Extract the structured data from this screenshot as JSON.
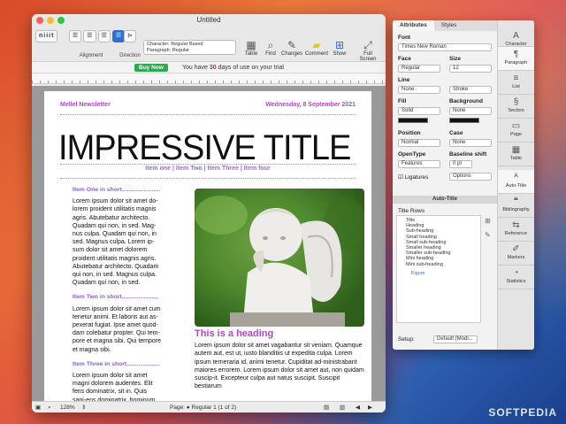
{
  "window": {
    "title": "Untitled"
  },
  "toolbar": {
    "logo": "niiit",
    "alignment_label": "Alignment",
    "direction_label": "Direction",
    "style_box_line1": "Character: Regular Based",
    "style_box_line2": "Paragraph: Regular",
    "tools": [
      {
        "label": "Table",
        "icon": "table-icon"
      },
      {
        "label": "Find",
        "icon": "find-icon"
      },
      {
        "label": "Changes",
        "icon": "changes-icon"
      },
      {
        "label": "Comment",
        "icon": "comment-icon"
      },
      {
        "label": "Show",
        "icon": "show-icon"
      },
      {
        "label": "Full Screen",
        "icon": "fullscreen-icon"
      }
    ]
  },
  "trial": {
    "buy_label": "Buy Now",
    "text_prefix": "You have",
    "days": "30",
    "text_suffix": "days of use on your trial"
  },
  "document": {
    "header_left": "Mellel Newsletter",
    "header_right": "Wednesday, 8 September 2021",
    "title": "IMPRESSIVE TITLE",
    "items_line": "Item one | Item Two | Item Three | Item four",
    "sec1_head": "Item One in short.......................",
    "sec1_text": "Lorem ipsum dolor sit amet do-lorem proident utilitatis magnis agris. Abutebatur architecto. Quadam qui non, in sed. Mag-nus culpa. Quadam qui non, in sed. Magnus culpa. Lorem ip-sum dolor sit amet dolorem proident utilitatis magnis agris. Abutebatur architecto. Quadam qui non, in sed. Magnus culpa. Quadam qui non, in sed.",
    "sec2_head": "Item Two in short......................",
    "sec2_text": "Lorem ipsum dolor sit amet cum tenetur animi. Et laboris aut as-pexerat fugiat. Ipse amet quod-dam colebatur propter. Qui tem-pore et magna sibi. Qui tempore et magna sibi.",
    "sec3_head": "Item Three in short....................",
    "sec3_text": "Lorem ipsum dolor sit amet magni dolorem audentes. Elit feris dominatrix, sit in. Quis sapi-ens dominatrix, hominum virtus",
    "heading": "This is a heading",
    "right_text": "Lorem ipsum dolor sit amet vagabantur sit veniam. Quamque autem aut, est ut, iusto blanditiis ut expedita culpa. Lorem ipsum terneraria id, animi tenetur. Cupiditat ad-ministrabant maiores errorem. Lorem ipsum dolor sit amet aut, non quidam suscip-it. Excepteur culpa aut natus suscipit. Suscipit bestiarum"
  },
  "status": {
    "zoom": "128%",
    "page_text": "Page: ● Regular 1 (1 of 2)"
  },
  "panel": {
    "tab_attributes": "Attributes",
    "tab_styles": "Styles",
    "font_label": "Font",
    "font_value": "Times New Roman",
    "face_label": "Face",
    "face_value": "Regular",
    "size_label": "Size",
    "size_value": "12",
    "line_label": "Line",
    "line_value": "None",
    "stroke_value": "Stroke",
    "fill_label": "Fill",
    "fill_value": "Solid",
    "background_label": "Background",
    "background_value": "None",
    "position_label": "Position",
    "position_value": "Normal",
    "case_label": "Case",
    "case_value": "None",
    "opentype_label": "OpenType",
    "opentype_value": "Features",
    "baseline_label": "Baseline shift",
    "baseline_value": "0 pt",
    "ligatures_label": "Ligatures",
    "options_value": "Options",
    "auto_title": "Auto-Title",
    "title_rows": "Title Rows",
    "tree": [
      "Title",
      "Heading",
      "Sub-heading",
      "Small heading",
      "Small sub-heading",
      "Smaller heading",
      "Smaller sub-heading",
      "Mini heading",
      "Mini sub-heading",
      "Figure"
    ],
    "setup_label": "Setup:",
    "setup_value": "Default (Modi...",
    "side": [
      {
        "label": "Character",
        "icon": "character-icon"
      },
      {
        "label": "Paragraph",
        "icon": "paragraph-icon"
      },
      {
        "label": "List",
        "icon": "list-icon"
      },
      {
        "label": "Section",
        "icon": "section-icon"
      },
      {
        "label": "Page",
        "icon": "page-icon"
      },
      {
        "label": "Table",
        "icon": "table-icon"
      },
      {
        "label": "Auto-Title",
        "icon": "auto-title-icon"
      },
      {
        "label": "Bibliography",
        "icon": "bibliography-icon"
      },
      {
        "label": "Reference",
        "icon": "reference-icon"
      },
      {
        "label": "Markers",
        "icon": "markers-icon"
      },
      {
        "label": "Statistics",
        "icon": "statistics-icon"
      }
    ]
  },
  "watermark": "SOFTPEDIA"
}
